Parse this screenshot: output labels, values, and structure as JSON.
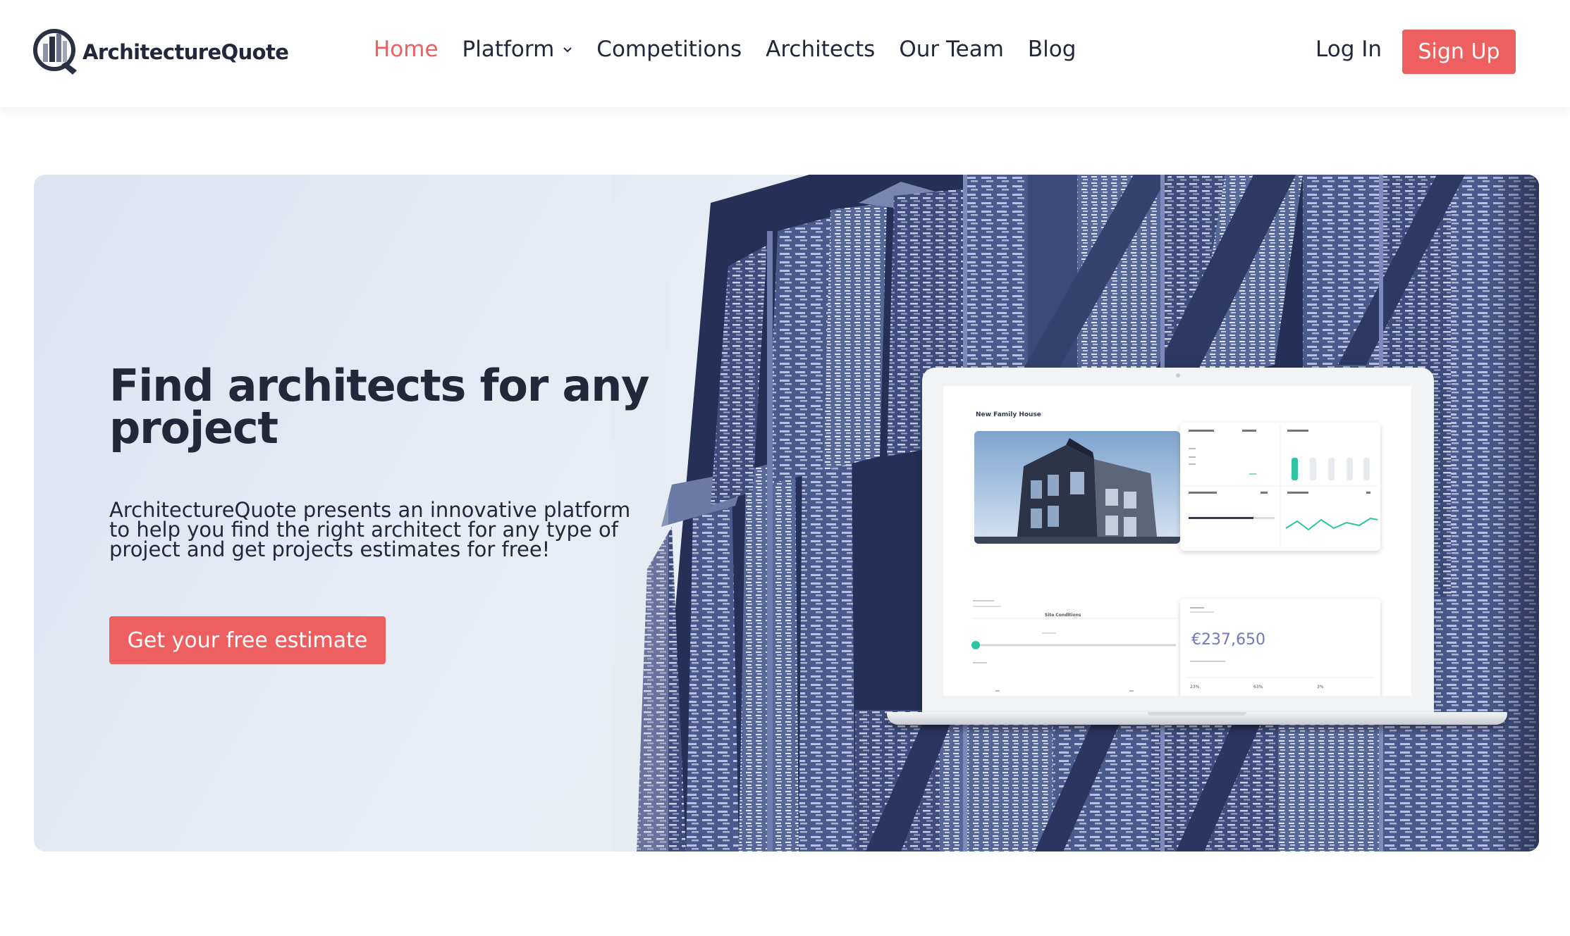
{
  "brand": {
    "name": "ArchitectureQuote",
    "accent": "#ee5f5f",
    "text_color": "#23273a"
  },
  "nav": {
    "items": [
      {
        "label": "Home",
        "active": true
      },
      {
        "label": "Platform",
        "has_dropdown": true
      },
      {
        "label": "Competitions"
      },
      {
        "label": "Architects"
      },
      {
        "label": "Our Team"
      },
      {
        "label": "Blog"
      }
    ],
    "login_label": "Log In",
    "signup_label": "Sign Up"
  },
  "hero": {
    "title": "Find architects for any project",
    "description": "ArchitectureQuote presents an innovative platform to help you find the right architect for any type of project and get projects estimates for free!",
    "cta_label": "Get your free estimate"
  },
  "dashboard_preview": {
    "project_title": "New Family House",
    "estimate": "€237,650",
    "section_label": "Site Conditions",
    "percent_a": "23%",
    "percent_b": "63%",
    "percent_c": "3%",
    "completion_pct": "70%"
  }
}
